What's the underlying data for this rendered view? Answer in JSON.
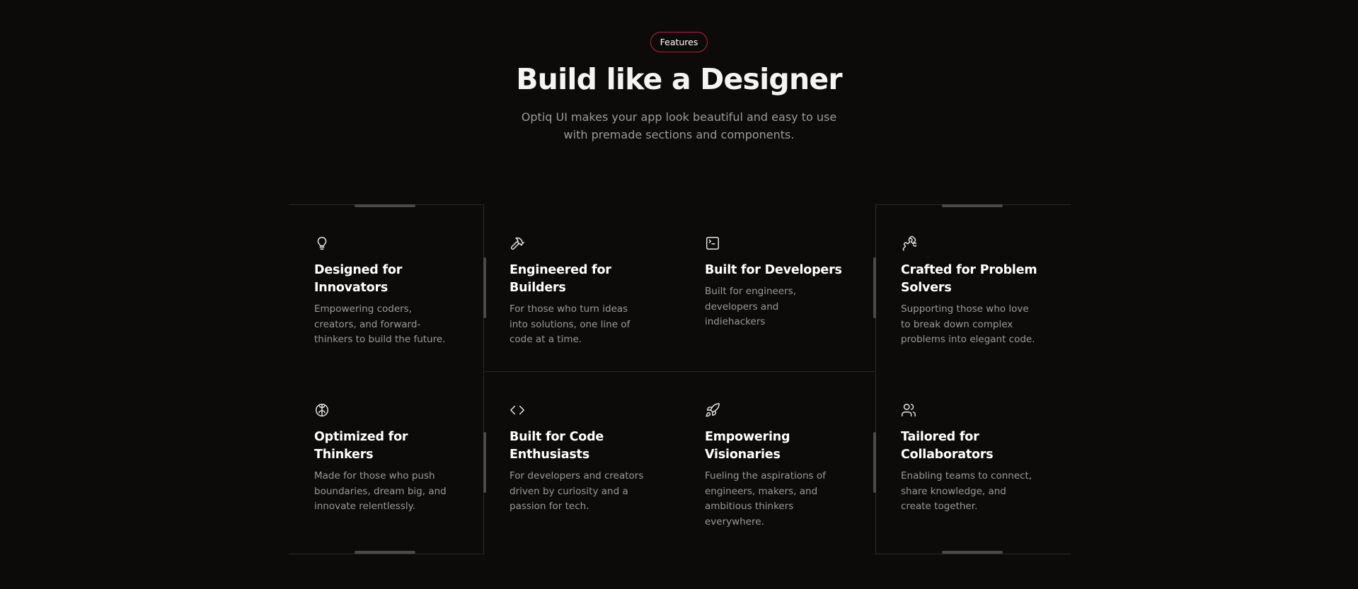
{
  "header": {
    "badge": "Features",
    "title": "Build like a Designer",
    "subtitle_line1": "Optiq UI makes your app look beautiful and easy to use",
    "subtitle_line2": "with premade sections and components."
  },
  "features": [
    {
      "icon": "lightbulb-icon",
      "title": "Designed for Innovators",
      "description": "Empowering coders, creators, and forward-thinkers to build the future."
    },
    {
      "icon": "hammer-icon",
      "title": "Engineered for Builders",
      "description": "For those who turn ideas into solutions, one line of code at a time."
    },
    {
      "icon": "terminal-icon",
      "title": "Built for Developers",
      "description": "Built for engineers, developers and indiehackers"
    },
    {
      "icon": "puzzle-icon",
      "title": "Crafted for Problem Solvers",
      "description": "Supporting those who love to break down complex problems into elegant code."
    },
    {
      "icon": "brain-icon",
      "title": "Optimized for Thinkers",
      "description": "Made for those who push boundaries, dream big, and innovate relentlessly."
    },
    {
      "icon": "code-icon",
      "title": "Built for Code Enthusiasts",
      "description": "For developers and creators driven by curiosity and a passion for tech."
    },
    {
      "icon": "rocket-icon",
      "title": "Empowering Visionaries",
      "description": "Fueling the aspirations of engineers, makers, and ambitious thinkers everywhere."
    },
    {
      "icon": "users-icon",
      "title": "Tailored for Collaborators",
      "description": "Enabling teams to connect, share knowledge, and create together."
    }
  ],
  "colors": {
    "background": "#0c0b0a",
    "badge_border": "#b3233d",
    "heading": "#f4f4f4",
    "body_text": "#9a9a9a",
    "grid_line": "#2a2a2a"
  }
}
